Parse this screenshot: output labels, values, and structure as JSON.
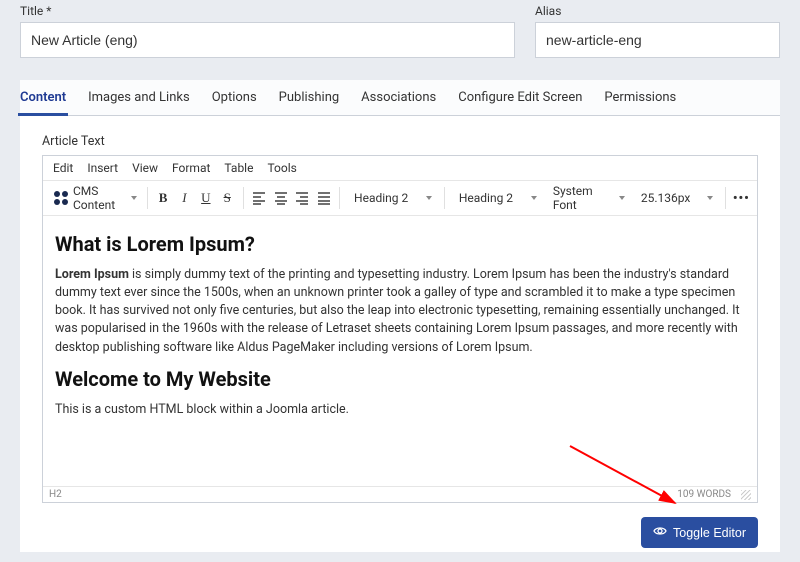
{
  "fields": {
    "title_label": "Title *",
    "title_value": "New Article (eng)",
    "alias_label": "Alias",
    "alias_value": "new-article-eng"
  },
  "tabs": [
    "Content",
    "Images and Links",
    "Options",
    "Publishing",
    "Associations",
    "Configure Edit Screen",
    "Permissions"
  ],
  "editor": {
    "label": "Article Text",
    "menu": [
      "Edit",
      "Insert",
      "View",
      "Format",
      "Table",
      "Tools"
    ],
    "cms_label": "CMS Content",
    "selects": {
      "block1": "Heading 2",
      "block2": "Heading 2",
      "font": "System Font",
      "size": "25.136px"
    },
    "status_path": "H2",
    "word_count": "109 WORDS"
  },
  "content": {
    "h1": "What is Lorem Ipsum?",
    "p1_strong": "Lorem Ipsum",
    "p1_rest": " is simply dummy text of the printing and typesetting industry. Lorem Ipsum has been the industry's standard dummy text ever since the 1500s, when an unknown printer took a galley of type and scrambled it to make a type specimen book. It has survived not only five centuries, but also the leap into electronic typesetting, remaining essentially unchanged. It was popularised in the 1960s with the release of Letraset sheets containing Lorem Ipsum passages, and more recently with desktop publishing software like Aldus PageMaker including versions of Lorem Ipsum.",
    "h2": "Welcome to My Website",
    "p2": "This is a custom HTML block within a Joomla article."
  },
  "buttons": {
    "toggle": "Toggle Editor"
  }
}
